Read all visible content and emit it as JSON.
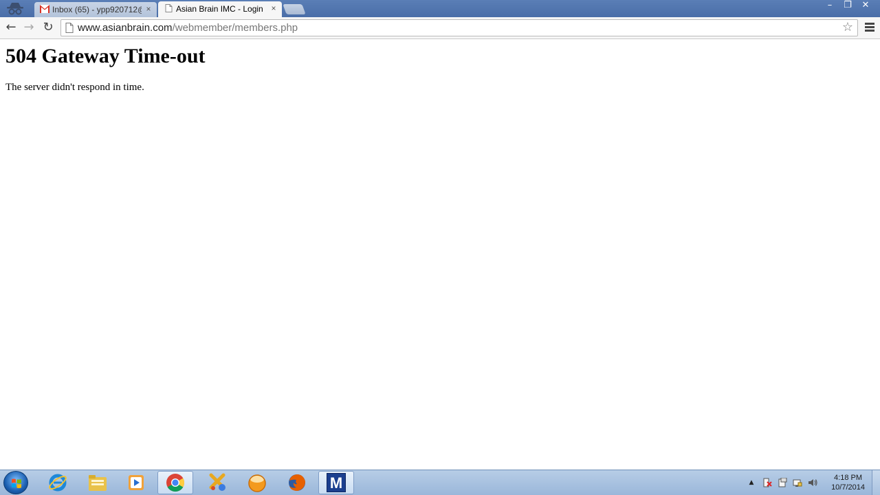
{
  "browser": {
    "tabs": [
      {
        "title": "Inbox (65) - ypp920712@g",
        "icon": "gmail-icon",
        "close": "×",
        "active": false
      },
      {
        "title": "Asian Brain IMC - Login",
        "icon": "page-icon",
        "close": "×",
        "active": true
      }
    ],
    "window_controls": {
      "minimize": "–",
      "maximize": "❐",
      "close": "✕"
    },
    "toolbar": {
      "back": "←",
      "forward": "→",
      "reload": "↻",
      "url_host": "www.asianbrain.com",
      "url_path": "/webmember/members.php",
      "bookmark_star": "☆"
    }
  },
  "page": {
    "title": "504 Gateway Time-out",
    "message": "The server didn't respond in time."
  },
  "taskbar": {
    "pinned": [
      {
        "name": "internet-explorer-icon",
        "active": false
      },
      {
        "name": "file-explorer-icon",
        "active": false
      },
      {
        "name": "media-player-icon",
        "active": false
      },
      {
        "name": "chrome-icon",
        "active": true
      },
      {
        "name": "games-icon",
        "active": false
      },
      {
        "name": "orange-app-icon",
        "active": false
      },
      {
        "name": "firefox-icon",
        "active": false
      },
      {
        "name": "m-app-icon",
        "active": true,
        "label": "M"
      }
    ],
    "tray_arrow": "▲",
    "clock": {
      "time": "4:18 PM",
      "date": "10/7/2014"
    }
  },
  "colors": {
    "titlebar": "#5a7eb6",
    "taskbar": "#a9c2e0",
    "gmail_red": "#d93025"
  }
}
